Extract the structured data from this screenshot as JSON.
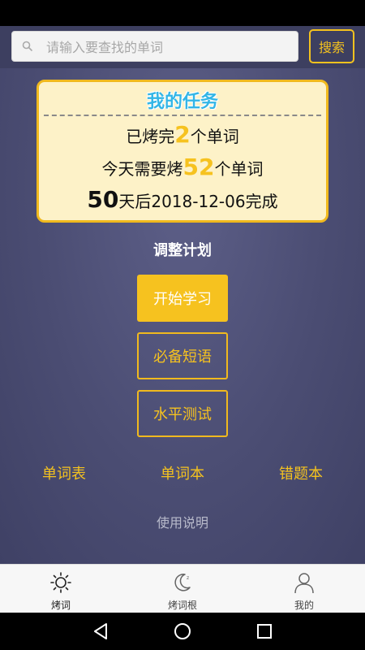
{
  "search": {
    "placeholder": "请输入要查找的单词",
    "button_label": "搜索"
  },
  "task": {
    "title": "我的任务",
    "line1_prefix": "已烤完",
    "line1_count": "2",
    "line1_suffix": "个单词",
    "line2_prefix": "今天需要烤",
    "line2_count": "52",
    "line2_suffix": "个单词",
    "line3_days": "50",
    "line3_text": "天后2018-12-06完成"
  },
  "plan_link": "调整计划",
  "buttons": {
    "start": "开始学习",
    "phrases": "必备短语",
    "level_test": "水平测试"
  },
  "links": {
    "word_list": "单词表",
    "word_book": "单词本",
    "mistakes": "错题本"
  },
  "manual_link": "使用说明",
  "tabs": [
    {
      "label": "烤词",
      "icon": "sun-icon"
    },
    {
      "label": "烤词根",
      "icon": "moon-icon"
    },
    {
      "label": "我的",
      "icon": "person-icon"
    }
  ],
  "colors": {
    "accent": "#f6c21f",
    "title_blue": "#33b6e6",
    "card_bg": "#fdf2c8",
    "background": "#4b4d73"
  }
}
